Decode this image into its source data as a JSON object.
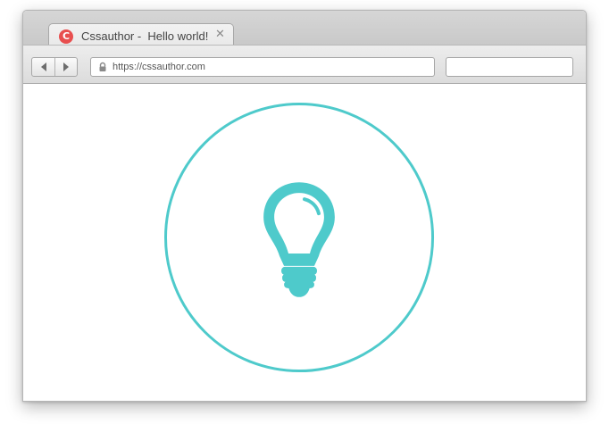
{
  "tab": {
    "favicon_letter": "C",
    "title": "Cssauthor -  Hello world!",
    "close_glyph": "✕"
  },
  "toolbar": {
    "back_icon": "back-arrow-icon",
    "forward_icon": "forward-arrow-icon",
    "lock_icon": "lock-icon",
    "url": "https://cssauthor.com",
    "search_value": ""
  },
  "content": {
    "icon": "lightbulb-icon",
    "accent_color": "#4ecacb"
  },
  "colors": {
    "favicon": "#e84f4f",
    "accent": "#4ecacb"
  }
}
